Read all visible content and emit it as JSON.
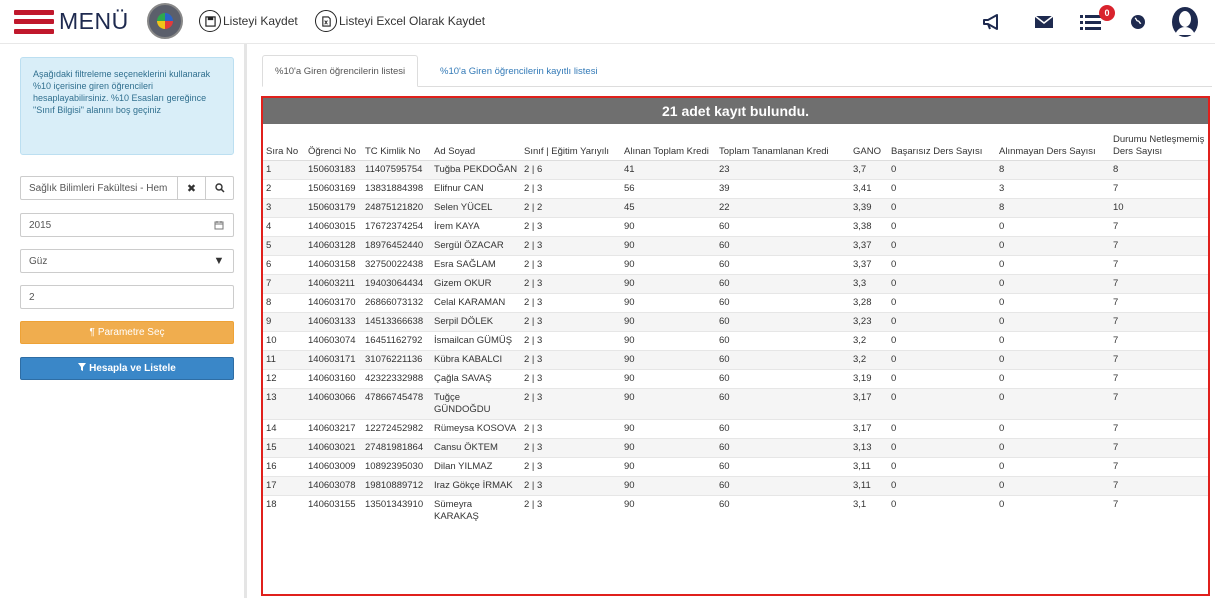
{
  "header": {
    "menu_label": "MENÜ",
    "save_label": "Listeyi Kaydet",
    "excel_label": "Listeyi Excel Olarak Kaydet",
    "notification_count": "0",
    "brand_color": "#c0182c"
  },
  "sidebar": {
    "info_text": "Aşağıdaki filtreleme seçeneklerini kullanarak %10 içerisine giren öğrencileri hesaplayabilirsiniz. %10 Esasları gereğince \"Sınıf Bilgisi\" alanını boş geçiniz",
    "faculty_value": "Sağlık Bilimleri Fakültesi - Hem",
    "year_value": "2015",
    "term_value": "Güz",
    "class_value": "2",
    "param_button": "Parametre Seç",
    "calc_button": "Hesapla ve Listele"
  },
  "tabs": [
    {
      "label": "%10'a Giren öğrencilerin listesi",
      "active": true
    },
    {
      "label": "%10'a Giren öğrencilerin kayıtlı listesi",
      "active": false
    }
  ],
  "table": {
    "title": "21 adet kayıt bulundu.",
    "headers": [
      "Sıra No",
      "Öğrenci No",
      "TC Kimlik No",
      "Ad Soyad",
      "Sınıf | Eğitim Yarıyılı",
      "Alınan Toplam Kredi",
      "Toplam Tanamlanan Kredi",
      "GANO",
      "Başarısız Ders Sayısı",
      "Alınmayan Ders Sayısı",
      "Durumu Netleşmemiş Ders Sayısı"
    ],
    "rows": [
      [
        "1",
        "150603183",
        "11407595754",
        "Tuğba PEKDOĞAN",
        "2 | 6",
        "41",
        "23",
        "3,7",
        "0",
        "8",
        "8"
      ],
      [
        "2",
        "150603169",
        "13831884398",
        "Elifnur CAN",
        "2 | 3",
        "56",
        "39",
        "3,41",
        "0",
        "3",
        "7"
      ],
      [
        "3",
        "150603179",
        "24875121820",
        "Selen YÜCEL",
        "2 | 2",
        "45",
        "22",
        "3,39",
        "0",
        "8",
        "10"
      ],
      [
        "4",
        "140603015",
        "17672374254",
        "İrem KAYA",
        "2 | 3",
        "90",
        "60",
        "3,38",
        "0",
        "0",
        "7"
      ],
      [
        "5",
        "140603128",
        "18976452440",
        "Sergül ÖZACAR",
        "2 | 3",
        "90",
        "60",
        "3,37",
        "0",
        "0",
        "7"
      ],
      [
        "6",
        "140603158",
        "32750022438",
        "Esra SAĞLAM",
        "2 | 3",
        "90",
        "60",
        "3,37",
        "0",
        "0",
        "7"
      ],
      [
        "7",
        "140603211",
        "19403064434",
        "Gizem OKUR",
        "2 | 3",
        "90",
        "60",
        "3,3",
        "0",
        "0",
        "7"
      ],
      [
        "8",
        "140603170",
        "26866073132",
        "Celal KARAMAN",
        "2 | 3",
        "90",
        "60",
        "3,28",
        "0",
        "0",
        "7"
      ],
      [
        "9",
        "140603133",
        "14513366638",
        "Serpil DÖLEK",
        "2 | 3",
        "90",
        "60",
        "3,23",
        "0",
        "0",
        "7"
      ],
      [
        "10",
        "140603074",
        "16451162792",
        "İsmailcan GÜMÜŞ",
        "2 | 3",
        "90",
        "60",
        "3,2",
        "0",
        "0",
        "7"
      ],
      [
        "11",
        "140603171",
        "31076221136",
        "Kübra KABALCI",
        "2 | 3",
        "90",
        "60",
        "3,2",
        "0",
        "0",
        "7"
      ],
      [
        "12",
        "140603160",
        "42322332988",
        "Çağla SAVAŞ",
        "2 | 3",
        "90",
        "60",
        "3,19",
        "0",
        "0",
        "7"
      ],
      [
        "13",
        "140603066",
        "47866745478",
        "Tuğçe GÜNDOĞDU",
        "2 | 3",
        "90",
        "60",
        "3,17",
        "0",
        "0",
        "7"
      ],
      [
        "14",
        "140603217",
        "12272452982",
        "Rümeysa KOSOVA",
        "2 | 3",
        "90",
        "60",
        "3,17",
        "0",
        "0",
        "7"
      ],
      [
        "15",
        "140603021",
        "27481981864",
        "Cansu ÖKTEM",
        "2 | 3",
        "90",
        "60",
        "3,13",
        "0",
        "0",
        "7"
      ],
      [
        "16",
        "140603009",
        "10892395030",
        "Dilan YILMAZ",
        "2 | 3",
        "90",
        "60",
        "3,11",
        "0",
        "0",
        "7"
      ],
      [
        "17",
        "140603078",
        "19810889712",
        "Iraz Gökçe İRMAK",
        "2 | 3",
        "90",
        "60",
        "3,11",
        "0",
        "0",
        "7"
      ],
      [
        "18",
        "140603155",
        "13501343910",
        "Sümeyra KARAKAŞ",
        "2 | 3",
        "90",
        "60",
        "3,1",
        "0",
        "0",
        "7"
      ]
    ]
  }
}
